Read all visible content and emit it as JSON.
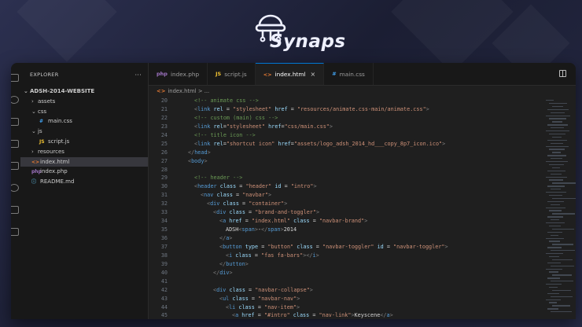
{
  "brand": {
    "name": "Synaps"
  },
  "explorer": {
    "title": "EXPLORER",
    "more": "···",
    "project": "ADSH-2014-WEBSITE",
    "items": [
      {
        "label": "assets",
        "kind": "folder",
        "open": false,
        "indent": 1
      },
      {
        "label": "css",
        "kind": "folder",
        "open": true,
        "indent": 1
      },
      {
        "label": "main.css",
        "kind": "css",
        "indent": 2
      },
      {
        "label": "js",
        "kind": "folder",
        "open": true,
        "indent": 1
      },
      {
        "label": "script.js",
        "kind": "js",
        "indent": 2
      },
      {
        "label": "resources",
        "kind": "folder",
        "open": false,
        "indent": 1
      },
      {
        "label": "index.html",
        "kind": "html",
        "indent": 1,
        "selected": true
      },
      {
        "label": "index.php",
        "kind": "php",
        "indent": 1
      },
      {
        "label": "README.md",
        "kind": "info",
        "indent": 1
      }
    ]
  },
  "tabs": [
    {
      "label": "index.php",
      "kind": "php",
      "active": false
    },
    {
      "label": "script.js",
      "kind": "js",
      "active": false
    },
    {
      "label": "index.html",
      "kind": "html",
      "active": true
    },
    {
      "label": "main.css",
      "kind": "css",
      "active": false
    }
  ],
  "breadcrumb": {
    "file": "index.html",
    "sep": ">",
    "more": "..."
  },
  "code": [
    {
      "n": "20",
      "i": 1,
      "tokens": [
        [
          "c",
          "<!-- animate css -->"
        ]
      ]
    },
    {
      "n": "21",
      "i": 1,
      "tokens": [
        [
          "p",
          "<"
        ],
        [
          "t",
          "link"
        ],
        [
          "a",
          " rel"
        ],
        [
          "w",
          " = "
        ],
        [
          "s",
          "\"stylesheet\""
        ],
        [
          "a",
          " href"
        ],
        [
          "w",
          " = "
        ],
        [
          "s",
          "\"resources/animate.css-main/animate.css\""
        ],
        [
          "p",
          ">"
        ]
      ]
    },
    {
      "n": "22",
      "i": 1,
      "tokens": [
        [
          "c",
          "<!-- custom (main) css -->"
        ]
      ]
    },
    {
      "n": "23",
      "i": 1,
      "tokens": [
        [
          "p",
          "<"
        ],
        [
          "t",
          "link"
        ],
        [
          "a",
          " rel"
        ],
        [
          "w",
          "="
        ],
        [
          "s",
          "\"stylesheet\""
        ],
        [
          "a",
          " href"
        ],
        [
          "w",
          "="
        ],
        [
          "s",
          "\"css/main.css\""
        ],
        [
          "p",
          ">"
        ]
      ]
    },
    {
      "n": "24",
      "i": 1,
      "tokens": [
        [
          "c",
          "<!-- title icon -->"
        ]
      ]
    },
    {
      "n": "25",
      "i": 1,
      "tokens": [
        [
          "p",
          "<"
        ],
        [
          "t",
          "link"
        ],
        [
          "a",
          " rel"
        ],
        [
          "w",
          "="
        ],
        [
          "s",
          "\"shortcut icon\""
        ],
        [
          "a",
          " href"
        ],
        [
          "w",
          "="
        ],
        [
          "s",
          "\"assets/logo_adsh_2014_hd___copy_8p7_icon.ico\""
        ],
        [
          "p",
          ">"
        ]
      ]
    },
    {
      "n": "26",
      "i": 0,
      "tokens": [
        [
          "p",
          "</"
        ],
        [
          "t",
          "head"
        ],
        [
          "p",
          ">"
        ]
      ]
    },
    {
      "n": "27",
      "i": 0,
      "tokens": [
        [
          "p",
          "<"
        ],
        [
          "t",
          "body"
        ],
        [
          "p",
          ">"
        ]
      ]
    },
    {
      "n": "28",
      "i": 0,
      "tokens": []
    },
    {
      "n": "29",
      "i": 1,
      "tokens": [
        [
          "c",
          "<!-- header -->"
        ]
      ]
    },
    {
      "n": "30",
      "i": 1,
      "tokens": [
        [
          "p",
          "<"
        ],
        [
          "t",
          "header"
        ],
        [
          "a",
          " class"
        ],
        [
          "w",
          " = "
        ],
        [
          "s",
          "\"header\""
        ],
        [
          "a",
          " id"
        ],
        [
          "w",
          " = "
        ],
        [
          "s",
          "\"intro\""
        ],
        [
          "p",
          ">"
        ]
      ]
    },
    {
      "n": "31",
      "i": 2,
      "tokens": [
        [
          "p",
          "<"
        ],
        [
          "t",
          "nav"
        ],
        [
          "a",
          " class"
        ],
        [
          "w",
          " = "
        ],
        [
          "s",
          "\"navbar\""
        ],
        [
          "p",
          ">"
        ]
      ]
    },
    {
      "n": "32",
      "i": 3,
      "tokens": [
        [
          "p",
          "<"
        ],
        [
          "t",
          "div"
        ],
        [
          "a",
          " class"
        ],
        [
          "w",
          " = "
        ],
        [
          "s",
          "\"container\""
        ],
        [
          "p",
          ">"
        ]
      ]
    },
    {
      "n": "33",
      "i": 4,
      "tokens": [
        [
          "p",
          "<"
        ],
        [
          "t",
          "div"
        ],
        [
          "a",
          " class"
        ],
        [
          "w",
          " = "
        ],
        [
          "s",
          "\"brand-and-toggler\""
        ],
        [
          "p",
          ">"
        ]
      ]
    },
    {
      "n": "34",
      "i": 5,
      "tokens": [
        [
          "p",
          "<"
        ],
        [
          "t",
          "a"
        ],
        [
          "a",
          " href"
        ],
        [
          "w",
          " = "
        ],
        [
          "s",
          "\"index.html\""
        ],
        [
          "a",
          " class"
        ],
        [
          "w",
          " = "
        ],
        [
          "s",
          "\"navbar-brand\""
        ],
        [
          "p",
          ">"
        ]
      ]
    },
    {
      "n": "35",
      "i": 6,
      "tokens": [
        [
          "w",
          "ADSH"
        ],
        [
          "p",
          "<"
        ],
        [
          "t",
          "span"
        ],
        [
          "p",
          ">"
        ],
        [
          "w",
          "-"
        ],
        [
          "p",
          "</"
        ],
        [
          "t",
          "span"
        ],
        [
          "p",
          ">"
        ],
        [
          "w",
          "2014"
        ]
      ]
    },
    {
      "n": "36",
      "i": 5,
      "tokens": [
        [
          "p",
          "</"
        ],
        [
          "t",
          "a"
        ],
        [
          "p",
          ">"
        ]
      ]
    },
    {
      "n": "37",
      "i": 5,
      "tokens": [
        [
          "p",
          "<"
        ],
        [
          "t",
          "button"
        ],
        [
          "a",
          " type"
        ],
        [
          "w",
          " = "
        ],
        [
          "s",
          "\"button\""
        ],
        [
          "a",
          " class"
        ],
        [
          "w",
          " = "
        ],
        [
          "s",
          "\"navbar-toggler\""
        ],
        [
          "a",
          " id"
        ],
        [
          "w",
          " = "
        ],
        [
          "s",
          "\"navbar-toggler\""
        ],
        [
          "p",
          ">"
        ]
      ]
    },
    {
      "n": "38",
      "i": 6,
      "tokens": [
        [
          "p",
          "<"
        ],
        [
          "t",
          "i"
        ],
        [
          "a",
          " class"
        ],
        [
          "w",
          " = "
        ],
        [
          "s",
          "\"fas fa-bars\""
        ],
        [
          "p",
          "></"
        ],
        [
          "t",
          "i"
        ],
        [
          "p",
          ">"
        ]
      ]
    },
    {
      "n": "39",
      "i": 5,
      "tokens": [
        [
          "p",
          "</"
        ],
        [
          "t",
          "button"
        ],
        [
          "p",
          ">"
        ]
      ]
    },
    {
      "n": "40",
      "i": 4,
      "tokens": [
        [
          "p",
          "</"
        ],
        [
          "t",
          "div"
        ],
        [
          "p",
          ">"
        ]
      ]
    },
    {
      "n": "41",
      "i": 0,
      "tokens": []
    },
    {
      "n": "42",
      "i": 4,
      "tokens": [
        [
          "p",
          "<"
        ],
        [
          "t",
          "div"
        ],
        [
          "a",
          " class"
        ],
        [
          "w",
          " = "
        ],
        [
          "s",
          "\"navbar-collapse\""
        ],
        [
          "p",
          ">"
        ]
      ]
    },
    {
      "n": "43",
      "i": 5,
      "tokens": [
        [
          "p",
          "<"
        ],
        [
          "t",
          "ul"
        ],
        [
          "a",
          " class"
        ],
        [
          "w",
          " = "
        ],
        [
          "s",
          "\"navbar-nav\""
        ],
        [
          "p",
          ">"
        ]
      ]
    },
    {
      "n": "44",
      "i": 6,
      "tokens": [
        [
          "p",
          "<"
        ],
        [
          "t",
          "li"
        ],
        [
          "a",
          " class"
        ],
        [
          "w",
          " = "
        ],
        [
          "s",
          "\"nav-item\""
        ],
        [
          "p",
          ">"
        ]
      ]
    },
    {
      "n": "45",
      "i": 7,
      "tokens": [
        [
          "p",
          "<"
        ],
        [
          "t",
          "a"
        ],
        [
          "a",
          " href"
        ],
        [
          "w",
          " = "
        ],
        [
          "s",
          "\"#intro\""
        ],
        [
          "a",
          " class"
        ],
        [
          "w",
          " = "
        ],
        [
          "s",
          "\"nav-link\""
        ],
        [
          "p",
          ">"
        ],
        [
          "w",
          "Keyscene"
        ],
        [
          "p",
          "</"
        ],
        [
          "t",
          "a"
        ],
        [
          "p",
          ">"
        ]
      ]
    }
  ]
}
